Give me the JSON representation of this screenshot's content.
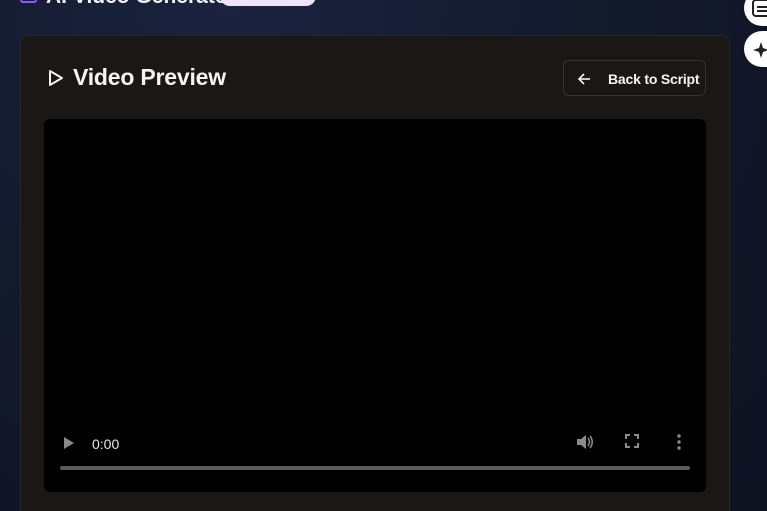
{
  "app": {
    "title": "AI Video Generator",
    "badge_color": "#f0e3fb",
    "icon": "film-icon"
  },
  "side_buttons": [
    {
      "icon": "captions-icon"
    },
    {
      "icon": "sparkles-icon"
    }
  ],
  "card": {
    "title": "Video Preview",
    "title_icon": "play-outline-icon",
    "back_button": {
      "label": "Back to Script",
      "icon": "arrow-left-icon"
    }
  },
  "player": {
    "current_time": "0:00",
    "progress": 0,
    "icons": [
      "play-icon",
      "volume-icon",
      "fullscreen-icon",
      "more-vertical-icon"
    ]
  },
  "colors": {
    "accent": "#8b5cf6",
    "card_bg": "#1b1715",
    "video_bg": "#000000"
  }
}
